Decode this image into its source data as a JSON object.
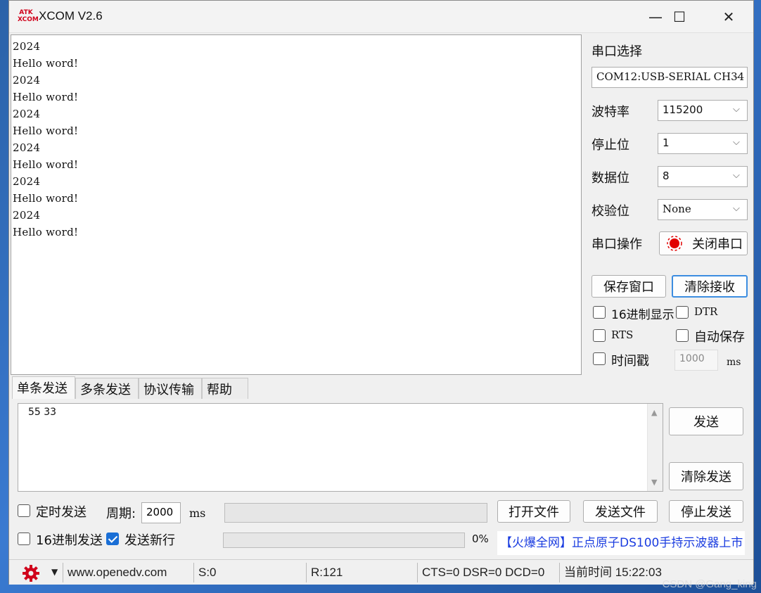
{
  "window": {
    "title": "XCOM V2.6",
    "logo_top": "ATK",
    "logo_bottom": "XCOM",
    "minimize": "—",
    "maximize": "☐",
    "close": "✕"
  },
  "receive": {
    "lines": [
      "2024",
      "Hello word!",
      "2024",
      "Hello word!",
      "2024",
      "Hello word!",
      "2024",
      "Hello word!",
      "2024",
      "Hello word!",
      "2024",
      "Hello word!"
    ]
  },
  "port_settings": {
    "port_label": "串口选择",
    "port_value": "COM12:USB-SERIAL CH34",
    "baud_label": "波特率",
    "baud_value": "115200",
    "stop_label": "停止位",
    "stop_value": "1",
    "data_label": "数据位",
    "data_value": "8",
    "parity_label": "校验位",
    "parity_value": "None",
    "op_label": "串口操作",
    "op_button": "关闭串口"
  },
  "receive_controls": {
    "save_window": "保存窗口",
    "clear_receive": "清除接收",
    "hex_display": "16进制显示",
    "dtr": "DTR",
    "rts": "RTS",
    "auto_save": "自动保存",
    "timestamp": "时间戳",
    "timestamp_value": "1000",
    "ms": "ms"
  },
  "tabs": [
    "单条发送",
    "多条发送",
    "协议传输",
    "帮助"
  ],
  "send": {
    "text": "55 33",
    "send_button": "发送",
    "clear_send_button": "清除发送",
    "timed_send": "定时发送",
    "period_label": "周期:",
    "period_value": "2000",
    "period_unit": "ms",
    "open_file": "打开文件",
    "send_file": "发送文件",
    "stop_send": "停止发送",
    "hex_send": "16进制发送",
    "send_newline": "发送新行",
    "progress_percent": "0%",
    "ad_text": "【火爆全网】正点原子DS100手持示波器上市"
  },
  "status": {
    "website": "www.openedv.com",
    "sent": "S:0",
    "received": "R:121",
    "lines": "CTS=0 DSR=0 DCD=0",
    "time": "当前时间 15:22:03"
  },
  "watermark": "CSDN @Gang_king",
  "colors": {
    "ad_text": "#1a3ce0",
    "accent": "#1a6fd6",
    "status_gear": "#d0021b"
  }
}
